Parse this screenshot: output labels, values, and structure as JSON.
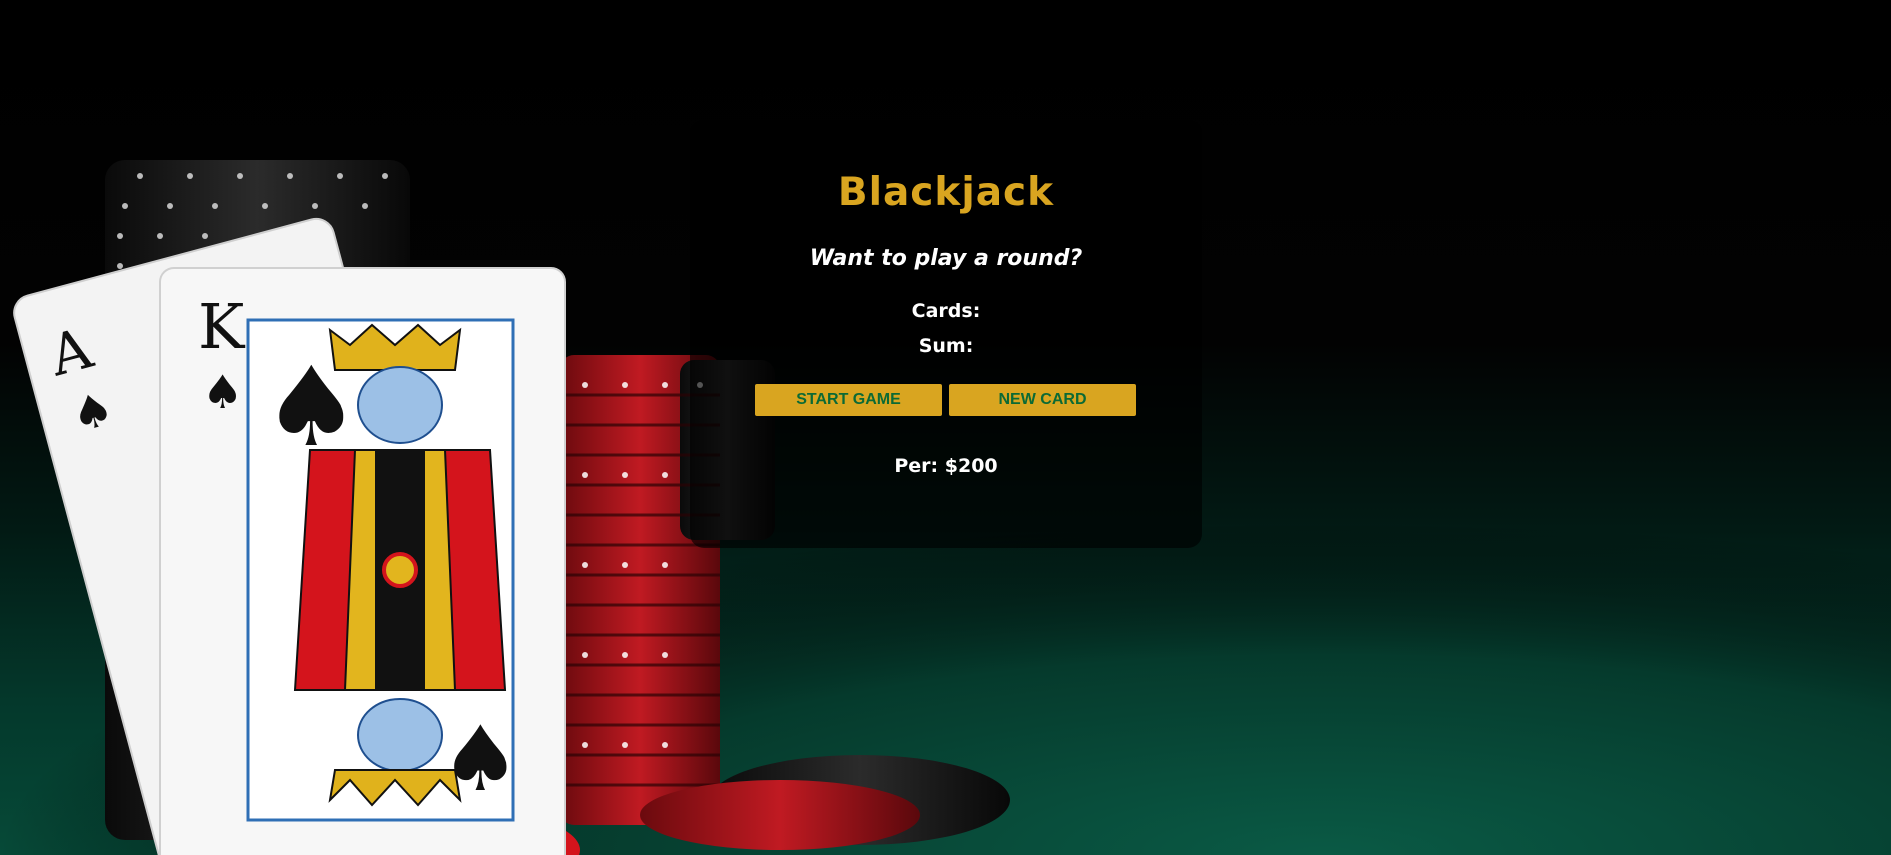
{
  "game": {
    "title": "Blackjack",
    "message": "Want to play a round?",
    "cards_label": "Cards:",
    "sum_label": "Sum:",
    "buttons": {
      "start": "START GAME",
      "new_card": "NEW CARD"
    },
    "player": "Per: $200"
  },
  "background": {
    "cards": [
      {
        "rank": "A",
        "suit": "♠"
      },
      {
        "rank": "K",
        "suit": "♠"
      }
    ],
    "chip_colors": [
      "#111111",
      "#b3141b"
    ]
  },
  "colors": {
    "accent": "#d9a520",
    "button_text": "#0b6a35",
    "text": "#ffffff",
    "felt": "#064a38"
  }
}
